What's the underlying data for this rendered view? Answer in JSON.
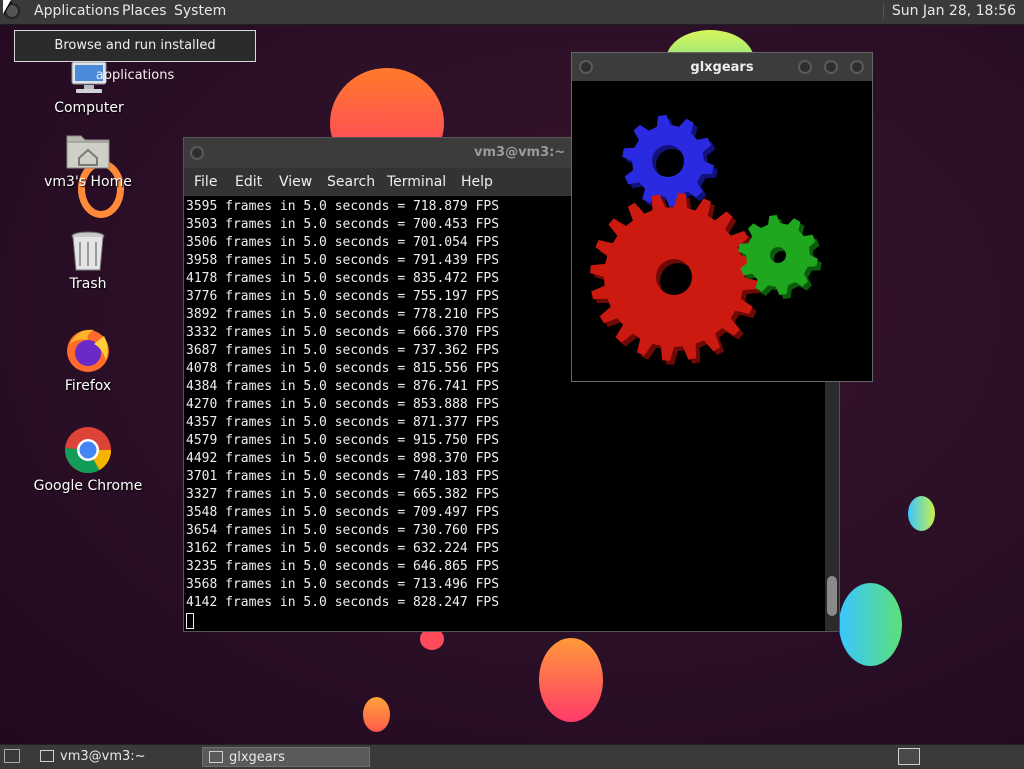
{
  "top_panel": {
    "menus": [
      "Applications",
      "Places",
      "System"
    ],
    "clock": "Sun Jan 28, 18:56"
  },
  "tooltip": "Browse and run installed applications",
  "desktop_icons": [
    {
      "label": "Computer"
    },
    {
      "label": "vm3's Home"
    },
    {
      "label": "Trash"
    },
    {
      "label": "Firefox"
    },
    {
      "label": "Google Chrome"
    }
  ],
  "terminal": {
    "title": "vm3@vm3:~",
    "menus": [
      "File",
      "Edit",
      "View",
      "Search",
      "Terminal",
      "Help"
    ],
    "lines": [
      "3595 frames in 5.0 seconds = 718.879 FPS",
      "3503 frames in 5.0 seconds = 700.453 FPS",
      "3506 frames in 5.0 seconds = 701.054 FPS",
      "3958 frames in 5.0 seconds = 791.439 FPS",
      "4178 frames in 5.0 seconds = 835.472 FPS",
      "3776 frames in 5.0 seconds = 755.197 FPS",
      "3892 frames in 5.0 seconds = 778.210 FPS",
      "3332 frames in 5.0 seconds = 666.370 FPS",
      "3687 frames in 5.0 seconds = 737.362 FPS",
      "4078 frames in 5.0 seconds = 815.556 FPS",
      "4384 frames in 5.0 seconds = 876.741 FPS",
      "4270 frames in 5.0 seconds = 853.888 FPS",
      "4357 frames in 5.0 seconds = 871.377 FPS",
      "4579 frames in 5.0 seconds = 915.750 FPS",
      "4492 frames in 5.0 seconds = 898.370 FPS",
      "3701 frames in 5.0 seconds = 740.183 FPS",
      "3327 frames in 5.0 seconds = 665.382 FPS",
      "3548 frames in 5.0 seconds = 709.497 FPS",
      "3654 frames in 5.0 seconds = 730.760 FPS",
      "3162 frames in 5.0 seconds = 632.224 FPS",
      "3235 frames in 5.0 seconds = 646.865 FPS",
      "3568 frames in 5.0 seconds = 713.496 FPS",
      "4142 frames in 5.0 seconds = 828.247 FPS"
    ]
  },
  "glxgears": {
    "title": "glxgears",
    "gear_colors": {
      "red": "#cc1a10",
      "green": "#1fa81f",
      "blue": "#2a2ae0"
    }
  },
  "taskbar": {
    "tasks": [
      {
        "label": "vm3@vm3:~",
        "active": false
      },
      {
        "label": "glxgears",
        "active": true
      }
    ]
  },
  "colors": {
    "panel": "#3a3a3a",
    "desktop_bg": "#2a0f24",
    "terminal_bg": "#000000",
    "terminal_fg": "#f0f0f0"
  }
}
